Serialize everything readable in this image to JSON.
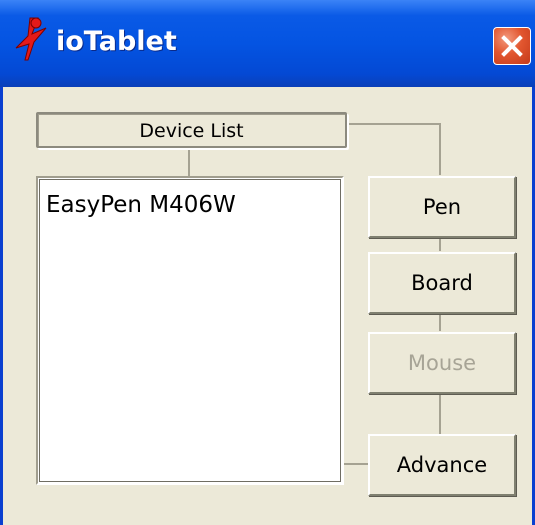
{
  "window": {
    "title": "ioTablet",
    "icons": {
      "app": "iotablet-logo-icon",
      "close": "close-icon"
    }
  },
  "device_list": {
    "header": "Device List",
    "items": [
      "EasyPen M406W"
    ]
  },
  "buttons": {
    "pen": "Pen",
    "board": "Board",
    "mouse": "Mouse",
    "advance": "Advance"
  },
  "colors": {
    "titlebar": "#0454e2",
    "dialog_face": "#ece9d8",
    "close_button": "#e2562f",
    "disabled_text": "#a7a496"
  }
}
